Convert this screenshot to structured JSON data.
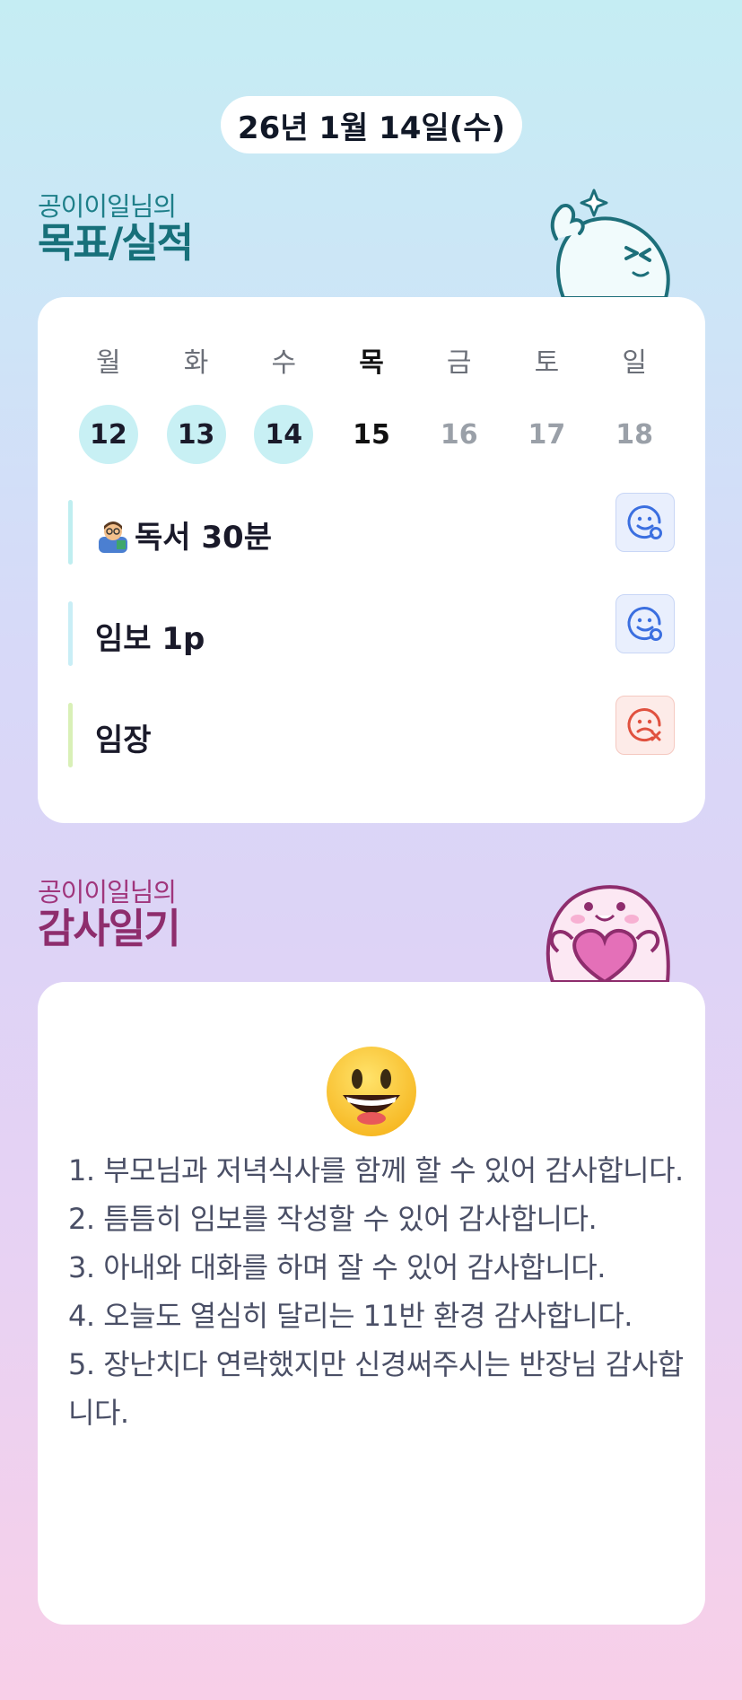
{
  "header": {
    "date": "26년 1월 14일(수)"
  },
  "goals_section": {
    "subtitle": "공이이일님의",
    "title": "목표/실적",
    "week": [
      {
        "name": "월",
        "num": "12",
        "state": "done"
      },
      {
        "name": "화",
        "num": "13",
        "state": "done"
      },
      {
        "name": "수",
        "num": "14",
        "state": "done"
      },
      {
        "name": "목",
        "num": "15",
        "state": "today"
      },
      {
        "name": "금",
        "num": "16",
        "state": "future"
      },
      {
        "name": "토",
        "num": "17",
        "state": "future"
      },
      {
        "name": "일",
        "num": "18",
        "state": "future"
      }
    ],
    "tasks": [
      {
        "label": "독서 30분",
        "icon": "man-teacher-emoji",
        "bar_color": "#bfeef0",
        "status": "success",
        "status_icon": "smile-face-check-icon"
      },
      {
        "label": "임보 1p",
        "icon": "",
        "bar_color": "#c9eef6",
        "status": "success",
        "status_icon": "smile-face-check-icon"
      },
      {
        "label": "임장",
        "icon": "",
        "bar_color": "#d9f0b7",
        "status": "fail",
        "status_icon": "sad-face-x-icon"
      }
    ]
  },
  "gratitude_section": {
    "subtitle": "공이이일님의",
    "title": "감사일기",
    "mood_icon": "grinning-face-emoji",
    "entries": [
      "1. 부모님과 저녁식사를 함께 할 수 있어 감사합니다.",
      "2. 틈틈히 임보를 작성할 수 있어 감사합니다.",
      "3. 아내와 대화를 하며 잘 수 있어 감사합니다.",
      "4. 오늘도 열심히 달리는 11반 환경 감사합니다.",
      "5. 장난치다 연락했지만 신경써주시는 반장님 감사합니다."
    ]
  },
  "colors": {
    "goal_title": "#17707a",
    "gratitude_title": "#8e2d6d",
    "done_day_bg": "#c8f0f4",
    "success_icon": "#3b6fe0",
    "fail_icon": "#e0513f"
  }
}
